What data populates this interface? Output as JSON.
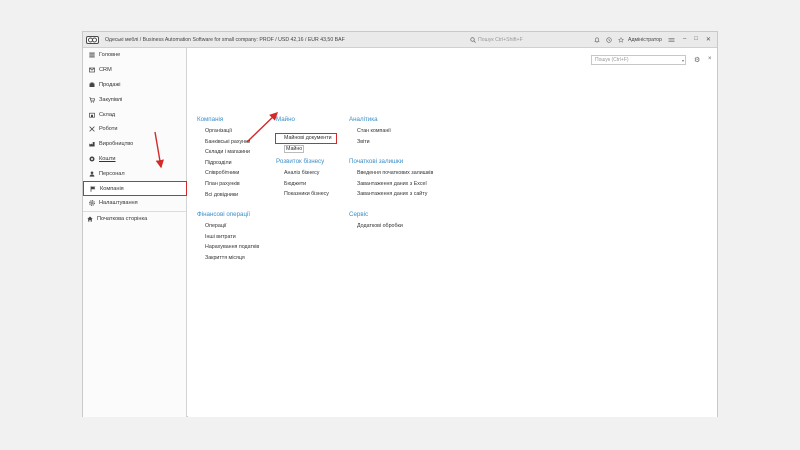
{
  "window": {
    "title": "Одеські меблі / Business Automation Software for small company: PROF / USD 42,16 / EUR 43,50 BAF",
    "search_placeholder": "Пошук Ctrl+Shift+F",
    "user": "Адміністратор"
  },
  "sidebar": {
    "items": [
      {
        "label": "Головне",
        "icon": "menu-icon"
      },
      {
        "label": "CRM",
        "icon": "crm-icon"
      },
      {
        "label": "Продажі",
        "icon": "sales-icon"
      },
      {
        "label": "Закупівлі",
        "icon": "purchases-icon"
      },
      {
        "label": "Склад",
        "icon": "warehouse-icon"
      },
      {
        "label": "Роботи",
        "icon": "tools-icon"
      },
      {
        "label": "Виробництво",
        "icon": "factory-icon"
      },
      {
        "label": "Кошти",
        "icon": "money-icon"
      },
      {
        "label": "Персонал",
        "icon": "person-icon"
      },
      {
        "label": "Компанія",
        "icon": "flag-icon"
      },
      {
        "label": "Налаштування",
        "icon": "gear-icon"
      }
    ],
    "home": "Початкова сторінка"
  },
  "main": {
    "search_placeholder": "Пошук (Ctrl+F)",
    "groups": {
      "company": {
        "title": "Компанія",
        "links": [
          "Організації",
          "Банківські рахунки",
          "Склади і магазини",
          "Підрозділи",
          "Співробітники",
          "План рахунків",
          "Всі довідники"
        ]
      },
      "finance": {
        "title": "Фінансові операції",
        "links": [
          "Операції",
          "Інші витрати",
          "Нарахування податків",
          "Закриття місяця"
        ]
      },
      "property": {
        "title": "Майно",
        "links": [
          "Майнові документи",
          "Майно"
        ]
      },
      "business": {
        "title": "Розвиток бізнесу",
        "links": [
          "Аналіз бізнесу",
          "Бюджети",
          "Показники бізнесу"
        ]
      },
      "analytics": {
        "title": "Аналітика",
        "links": [
          "Стан компанії",
          "Звіти"
        ]
      },
      "opening": {
        "title": "Початкові залишки",
        "links": [
          "Введення початкових залишків",
          "Завантаження даних з Excel",
          "Завантаження даних з сайту"
        ]
      },
      "service": {
        "title": "Сервіс",
        "links": [
          "Додаткові обробки"
        ]
      }
    }
  },
  "colors": {
    "accent": "#3b8ec9",
    "highlight": "#d42a2a"
  }
}
